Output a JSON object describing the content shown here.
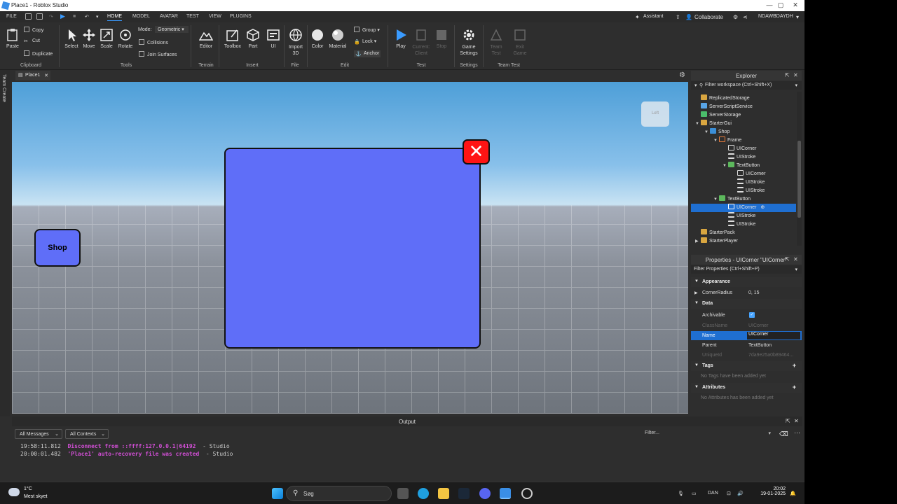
{
  "window": {
    "title": "Place1 - Roblox Studio"
  },
  "menubar": {
    "file": "FILE",
    "tabs": [
      "HOME",
      "MODEL",
      "AVATAR",
      "TEST",
      "VIEW",
      "PLUGINS"
    ],
    "assistant": "Assistant",
    "collaborate": "Collaborate",
    "user": "NDAWBDAYDH"
  },
  "ribbon": {
    "clipboard": {
      "paste": "Paste",
      "copy": "Copy",
      "cut": "Cut",
      "duplicate": "Duplicate",
      "group": "Clipboard"
    },
    "tools": {
      "select": "Select",
      "move": "Move",
      "scale": "Scale",
      "rotate": "Rotate",
      "mode_label": "Mode:",
      "mode_value": "Geometric",
      "collisions": "Collisions",
      "join_surfaces": "Join Surfaces",
      "group": "Tools"
    },
    "terrain": {
      "editor": "Editor",
      "group": "Terrain"
    },
    "insert": {
      "toolbox": "Toolbox",
      "part": "Part",
      "ui": "UI",
      "group": "Insert"
    },
    "file": {
      "import3d": "Import 3D",
      "group": "File"
    },
    "edit": {
      "color": "Color",
      "material": "Material",
      "group_btn": "Group",
      "lock": "Lock",
      "anchor": "Anchor",
      "group": "Edit"
    },
    "test": {
      "play": "Play",
      "current_client": "Current: Client",
      "stop": "Stop",
      "group": "Test"
    },
    "settings": {
      "game_settings": "Game Settings",
      "group": "Settings"
    },
    "team_test": {
      "team_test": "Team Test",
      "exit_game": "Exit Game",
      "group": "Team Test"
    }
  },
  "side_strip": {
    "label": "Team Create"
  },
  "doc_tab": {
    "label": "Place1"
  },
  "viewport": {
    "shop_button_text": "Shop",
    "close_glyph": "✕",
    "view_cube_label": "Left"
  },
  "explorer": {
    "title": "Explorer",
    "filter_placeholder": "Filter workspace (Ctrl+Shift+X)",
    "items": [
      {
        "label": "ReplicatedStorage"
      },
      {
        "label": "ServerScriptService"
      },
      {
        "label": "ServerStorage"
      },
      {
        "label": "StarterGui"
      },
      {
        "label": "Shop"
      },
      {
        "label": "Frame"
      },
      {
        "label": "UICorner"
      },
      {
        "label": "UIStroke"
      },
      {
        "label": "TextButton"
      },
      {
        "label": "UICorner"
      },
      {
        "label": "UIStroke"
      },
      {
        "label": "UIStroke"
      },
      {
        "label": "TextButton"
      },
      {
        "label": "UICorner"
      },
      {
        "label": "UIStroke"
      },
      {
        "label": "UIStroke"
      },
      {
        "label": "StarterPack"
      },
      {
        "label": "StarterPlayer"
      }
    ]
  },
  "properties": {
    "title": "Properties - UICorner \"UICorner\"",
    "filter_placeholder": "Filter Properties (Ctrl+Shift+P)",
    "sections": {
      "appearance": "Appearance",
      "data": "Data",
      "tags": "Tags",
      "attributes": "Attributes"
    },
    "rows": {
      "corner_radius_key": "CornerRadius",
      "corner_radius_val": "0, 15",
      "archivable_key": "Archivable",
      "classname_key": "ClassName",
      "classname_val": "UICorner",
      "name_key": "Name",
      "name_val": "UICorner",
      "parent_key": "Parent",
      "parent_val": "TextButton",
      "uniqueid_key": "UniqueId",
      "uniqueid_val": "7da9e25a0b89464..."
    },
    "tags_empty": "No Tags have been added yet",
    "attributes_empty": "No Attributes has been added yet"
  },
  "output": {
    "title": "Output",
    "messages_filter": "All Messages",
    "contexts_filter": "All Contexts",
    "filter_placeholder": "Filter...",
    "logs": [
      {
        "time": "19:58:11.812",
        "msg": "Disconnect from ::ffff:127.0.0.1|64192",
        "src": "-  Studio"
      },
      {
        "time": "20:00:01.482",
        "msg": "'Place1' auto-recovery file was created",
        "src": "-  Studio"
      }
    ]
  },
  "taskbar": {
    "temp": "1°C",
    "weather": "Mest skyet",
    "search": "Søg",
    "lang": "DAN",
    "time": "20:02",
    "date": "19-01-2025"
  },
  "colors": {
    "gui_fill": "#5f6ef8",
    "close_red": "#ff1414",
    "selection": "#1f6fd1",
    "log_magenta": "#d24fd6"
  }
}
